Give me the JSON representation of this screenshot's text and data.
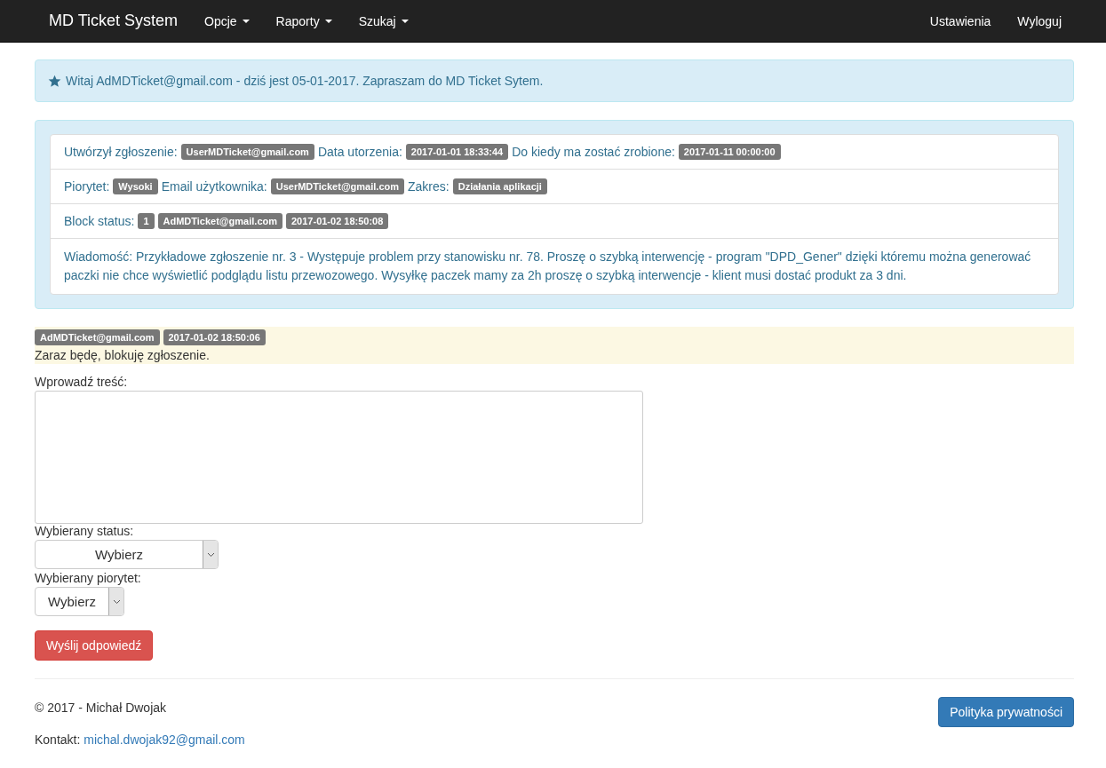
{
  "navbar": {
    "brand": "MD Ticket System",
    "menus": [
      {
        "label": "Opcje",
        "dropdown": true
      },
      {
        "label": "Raporty",
        "dropdown": true
      },
      {
        "label": "Szukaj",
        "dropdown": true
      }
    ],
    "right_links": [
      "Ustawienia",
      "Wyloguj"
    ]
  },
  "welcome": {
    "text": "Witaj AdMDTicket@gmail.com - dziś jest 05-01-2017. Zapraszam do MD Ticket Sytem."
  },
  "ticket_rows": [
    {
      "items": [
        {
          "kind": "label",
          "text": "Utwórzył zgłoszenie:"
        },
        {
          "kind": "badge",
          "text": "UserMDTicket@gmail.com"
        },
        {
          "kind": "label",
          "text": "Data utorzenia:"
        },
        {
          "kind": "badge",
          "text": "2017-01-01 18:33:44"
        },
        {
          "kind": "label",
          "text": "Do kiedy ma zostać zrobione:"
        },
        {
          "kind": "badge",
          "text": "2017-01-11 00:00:00"
        }
      ]
    },
    {
      "items": [
        {
          "kind": "label",
          "text": "Piorytet:"
        },
        {
          "kind": "badge",
          "text": "Wysoki"
        },
        {
          "kind": "label",
          "text": "Email użytkownika:"
        },
        {
          "kind": "badge",
          "text": "UserMDTicket@gmail.com"
        },
        {
          "kind": "label",
          "text": "Zakres:"
        },
        {
          "kind": "badge",
          "text": "Działania aplikacji"
        }
      ]
    },
    {
      "items": [
        {
          "kind": "label",
          "text": "Block status:"
        },
        {
          "kind": "badge",
          "text": "1"
        },
        {
          "kind": "badge",
          "text": "AdMDTicket@gmail.com"
        },
        {
          "kind": "badge",
          "text": "2017-01-02 18:50:08"
        }
      ]
    },
    {
      "items": [
        {
          "kind": "message",
          "text": "Wiadomość: Przykładowe zgłoszenie nr. 3 -  Występuje problem przy stanowisku nr. 78. Proszę o szybką interwencję - program \"DPD_Gener\" dzięki któremu można generować paczki nie chce wyświetlić podglądu listu przewozowego. Wysyłkę paczek mamy za 2h proszę o szybką interwencje - klient musi dostać produkt za 3 dni."
        }
      ]
    }
  ],
  "replies": [
    {
      "author": "AdMDTicket@gmail.com",
      "date": "2017-01-02 18:50:06",
      "text": "Zaraz będę, blokuję zgłoszenie."
    }
  ],
  "form": {
    "content_label": "Wprowadź treść:",
    "status_label": "Wybierany status:",
    "status_value": "Wybierz",
    "priority_label": "Wybierany piorytet:",
    "priority_value": "Wybierz",
    "submit": "Wyślij odpowiedź"
  },
  "footer": {
    "copyright": "© 2017 - Michał Dwojak",
    "contact_label": "Kontakt:",
    "contact_email": "michal.dwojak92@gmail.com",
    "privacy_button": "Polityka prywatności"
  }
}
